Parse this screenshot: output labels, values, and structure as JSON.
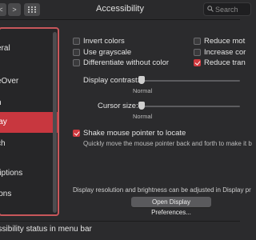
{
  "window": {
    "title": "Accessibility"
  },
  "toolbar": {
    "back_glyph": "<",
    "forward_glyph": ">",
    "grid_icon": "grid-icon",
    "search": {
      "placeholder": "Search",
      "icon": "search-icon"
    }
  },
  "sidebar": {
    "items": [
      {
        "label": "eral"
      },
      {
        "label": "eOver"
      },
      {
        "label": "n"
      },
      {
        "label": "lay"
      },
      {
        "label": "ch"
      },
      {
        "label": "riptions"
      },
      {
        "label": "ions"
      }
    ],
    "selected_index": 3
  },
  "options": {
    "invert_colors": {
      "label": "Invert colors",
      "checked": false
    },
    "use_grayscale": {
      "label": "Use grayscale",
      "checked": false
    },
    "differentiate": {
      "label": "Differentiate without color",
      "checked": false
    },
    "reduce_motion": {
      "label": "Reduce mot",
      "checked": false
    },
    "increase_contrast": {
      "label": "Increase cor",
      "checked": false
    },
    "reduce_transparency": {
      "label": "Reduce tran",
      "checked": true
    }
  },
  "display_contrast": {
    "label": "Display contrast:",
    "tick_label": "Normal",
    "level": 0
  },
  "cursor_size": {
    "label": "Cursor size:",
    "tick_label": "Normal",
    "level": 0
  },
  "shake": {
    "label": "Shake mouse pointer to locate",
    "checked": true,
    "description": "Quickly move the mouse pointer back and forth to make it b"
  },
  "display_info": "Display resolution and brightness can be adjusted in Display pr",
  "open_display_prefs_button": "Open Display Preferences...",
  "bottom": {
    "label": "essibility status in menu bar"
  },
  "colors": {
    "accent": "#d0393f",
    "selection": "#c8373f",
    "highlight_box": "#c8575b"
  }
}
